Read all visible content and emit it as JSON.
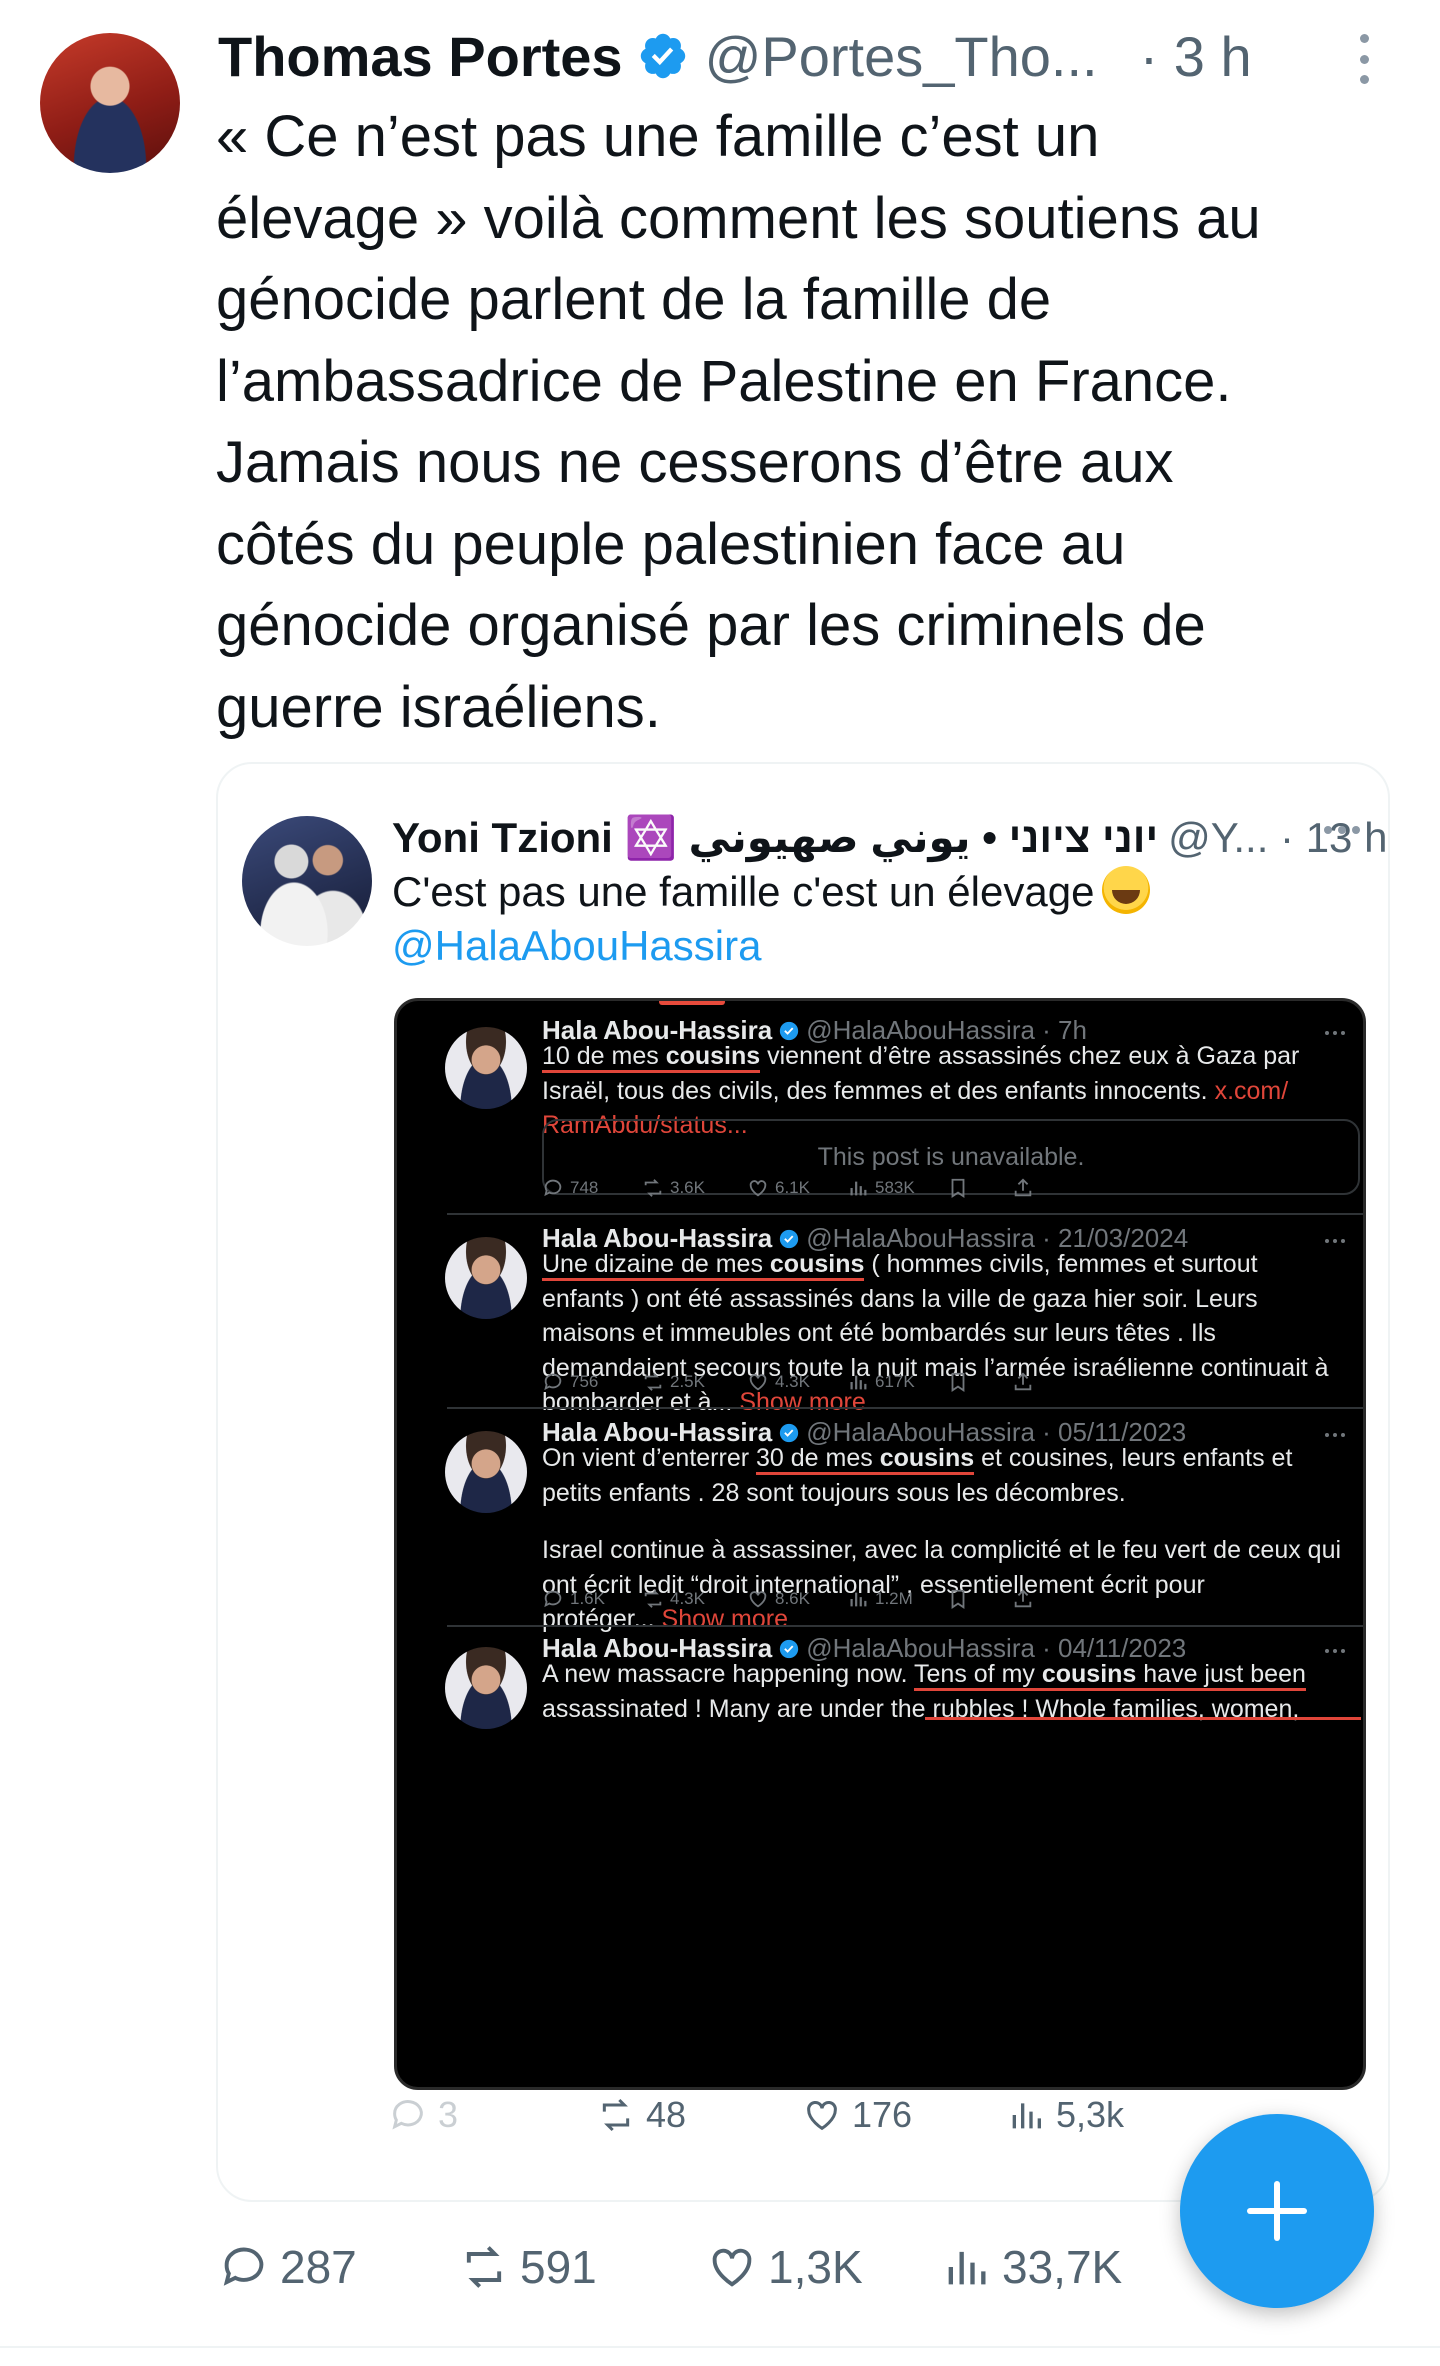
{
  "tweet": {
    "author_name": "Thomas Portes",
    "handle": "@Portes_Tho...",
    "time": "· 3 h",
    "text_lines": [
      "« Ce n’est pas une famille c’est un",
      "élevage » voilà comment les soutiens au",
      "génocide parlent de la famille de",
      "l’ambassadrice de Palestine en France.",
      "Jamais nous ne cesserons d’être aux",
      "côtés du peuple palestinien face au",
      "génocide organisé par les criminels de",
      "guerre israéliens."
    ],
    "stats": {
      "replies": "287",
      "reposts": "591",
      "likes": "1,3K",
      "views": "33,7K"
    }
  },
  "quote": {
    "author_name": "Yoni Tzioni ✡️ יוני ציוני • يوني صهيوني",
    "handle": "@Y... · 13 h",
    "text": "C'est pas une famille c'est un élevage",
    "mention": "@HalaAbouHassira",
    "stats": {
      "replies": "3",
      "reposts": "48",
      "likes": "176",
      "views": "5,3k"
    }
  },
  "screenshot_posts": [
    {
      "name": "Hala Abou-Hassira",
      "meta": "@HalaAbouHassira · 7h",
      "lines": [
        [
          "10 de mes ",
          "cousins",
          " viennent d’être assassinés chez eux à Gaza par"
        ],
        "Israël, tous des civils, des femmes et des enfants innocents.",
        "RamAbdu/status..."
      ],
      "link_start": "x.com/",
      "unavailable": "This post is unavailable.",
      "stats": [
        "748",
        "3.6K",
        "6.1K",
        "583K"
      ]
    },
    {
      "name": "Hala Abou-Hassira",
      "meta": "@HalaAbouHassira · 21/03/2024",
      "lines": [
        [
          "Une dizaine de mes ",
          "cousins",
          " ( hommes civils, femmes et surtout"
        ],
        "enfants ) ont été assassinés dans la ville de gaza hier soir. Leurs",
        "maisons et immeubles ont été bombardés sur leurs têtes . Ils",
        "demandaient secours toute la nuit mais l’armée israélienne continuait à",
        "bombarder et à..."
      ],
      "show_more": "Show more",
      "stats": [
        "756",
        "2.5K",
        "4.3K",
        "617K"
      ]
    },
    {
      "name": "Hala Abou-Hassira",
      "meta": "@HalaAbouHassira · 05/11/2023",
      "lines": [
        [
          "On vient d’enterrer ",
          "30 de mes ",
          "cousins",
          " et cousines, leurs enfants et"
        ],
        "petits enfants . 28 sont toujours sous les décombres.",
        "Israel continue à assassiner, avec la complicité et le feu vert de ceux qui",
        "ont écrit ledit  “droit international” , essentiellement écrit pour",
        "protéger..."
      ],
      "show_more": "Show more",
      "stats": [
        "1.6K",
        "4.3K",
        "8.6K",
        "1.2M"
      ]
    },
    {
      "name": "Hala Abou-Hassira",
      "meta": "@HalaAbouHassira · 04/11/2023",
      "lines": [
        [
          "A new massacre happening now. ",
          "Tens of my ",
          "cousins",
          " have just been"
        ],
        "assassinated ! Many are under the rubbles ! Whole families, women,"
      ]
    }
  ],
  "colors": {
    "accent": "#1d9bf0",
    "highlight_red": "#e0463a",
    "text_primary": "#0f1419",
    "text_secondary": "#536471"
  }
}
